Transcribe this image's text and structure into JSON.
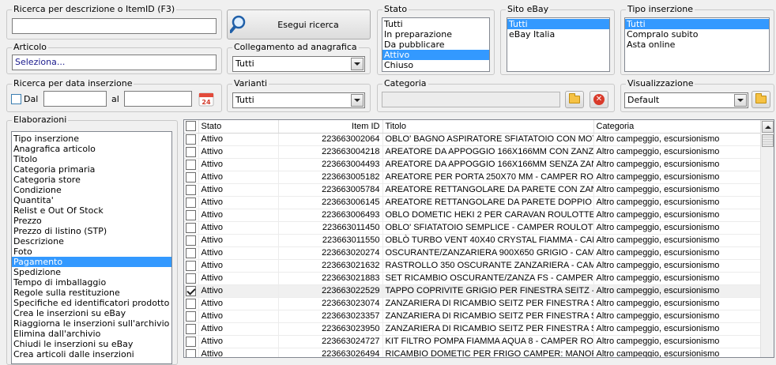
{
  "search": {
    "legend": "Ricerca per descrizione o ItemID (F3)",
    "value": "",
    "button_label": "Esegui ricerca"
  },
  "articolo": {
    "legend": "Articolo",
    "value": "Seleziona..."
  },
  "collegamento": {
    "legend": "Collegamento ad anagrafica",
    "value": "Tutti"
  },
  "stato": {
    "legend": "Stato",
    "options": [
      "Tutti",
      "In preparazione",
      "Da pubblicare",
      "Attivo",
      "Chiuso"
    ],
    "selected": "Attivo"
  },
  "sito": {
    "legend": "Sito eBay",
    "options": [
      "Tutti",
      "eBay Italia"
    ],
    "selected": "Tutti"
  },
  "tipo": {
    "legend": "Tipo inserzione",
    "options": [
      "Tutti",
      "Compralo subito",
      "Asta online"
    ],
    "selected": "Tutti"
  },
  "data": {
    "legend": "Ricerca per data inserzione",
    "dal_label": "Dal",
    "al_label": "al",
    "dal_value": "",
    "al_value": "",
    "calendar_text": "24"
  },
  "varianti": {
    "legend": "Varianti",
    "value": "Tutti"
  },
  "categoria": {
    "legend": "Categoria",
    "value": ""
  },
  "visualizzazione": {
    "legend": "Visualizzazione",
    "value": "Default"
  },
  "elaborazioni": {
    "legend": "Elaborazioni",
    "items": [
      "Tipo inserzione",
      "Anagrafica articolo",
      "Titolo",
      "Categoria primaria",
      "Categoria store",
      "Condizione",
      "Quantita'",
      "Relist e Out Of Stock",
      "Prezzo",
      "Prezzo di listino (STP)",
      "Descrizione",
      "Foto",
      "Pagamento",
      "Spedizione",
      "Tempo di imballaggio",
      "Regole sulla restituzione",
      "Specifiche ed identificatori prodotto",
      "Crea le inserzioni su eBay",
      "Riaggiorna le inserzioni sull'archivio",
      "Elimina dall'archivio",
      "Chiudi le inserzioni su eBay",
      "Crea articoli dalle inserzioni"
    ],
    "selected": "Pagamento"
  },
  "grid": {
    "columns": [
      "Stato",
      "Item ID",
      "Titolo",
      "Categoria"
    ],
    "rows": [
      {
        "checked": false,
        "stato": "Attivo",
        "id": "223663002064",
        "titolo": "OBLO' BAGNO ASPIRATORE SFIATATOIO CON MOT...",
        "categoria": "Altro campeggio, escursionismo"
      },
      {
        "checked": false,
        "stato": "Attivo",
        "id": "223663004218",
        "titolo": "AREATORE DA APPOGGIO 166X166MM CON ZANZA...",
        "categoria": "Altro campeggio, escursionismo"
      },
      {
        "checked": false,
        "stato": "Attivo",
        "id": "223663004493",
        "titolo": "AREATORE DA APPOGGIO 166X166MM SENZA ZAN...",
        "categoria": "Altro campeggio, escursionismo"
      },
      {
        "checked": false,
        "stato": "Attivo",
        "id": "223663005182",
        "titolo": "AREATORE PER PORTA 250X70 MM - CAMPER ROU...",
        "categoria": "Altro campeggio, escursionismo"
      },
      {
        "checked": false,
        "stato": "Attivo",
        "id": "223663005784",
        "titolo": "AREATORE RETTANGOLARE DA PARETE CON ZANZ...",
        "categoria": "Altro campeggio, escursionismo"
      },
      {
        "checked": false,
        "stato": "Attivo",
        "id": "223663006145",
        "titolo": "AREATORE RETTANGOLARE DA PARETE DOPPIO C...",
        "categoria": "Altro campeggio, escursionismo"
      },
      {
        "checked": false,
        "stato": "Attivo",
        "id": "223663006493",
        "titolo": "OBLO DOMETIC HEKI 2 PER CARAVAN ROULOTTE",
        "categoria": "Altro campeggio, escursionismo"
      },
      {
        "checked": false,
        "stato": "Attivo",
        "id": "223663011450",
        "titolo": "OBLO' SFIATATOIO SEMPLICE - CAMPER ROULOTTE",
        "categoria": "Altro campeggio, escursionismo"
      },
      {
        "checked": false,
        "stato": "Attivo",
        "id": "223663011550",
        "titolo": "OBLÒ TURBO VENT 40X40 CRYSTAL FIAMMA - CAM...",
        "categoria": "Altro campeggio, escursionismo"
      },
      {
        "checked": false,
        "stato": "Attivo",
        "id": "223663020274",
        "titolo": "OSCURANTE/ZANZARIERA 900X650 GRIGIO - CAM...",
        "categoria": "Altro campeggio, escursionismo"
      },
      {
        "checked": false,
        "stato": "Attivo",
        "id": "223663021632",
        "titolo": "RASTROLLO 350 OSCURANTE ZANZARIERA - CAMP...",
        "categoria": "Altro campeggio, escursionismo"
      },
      {
        "checked": false,
        "stato": "Attivo",
        "id": "223663021883",
        "titolo": "SET RICAMBIO OSCURANTE/ZANZA FS - CAMPER R...",
        "categoria": "Altro campeggio, escursionismo"
      },
      {
        "checked": true,
        "stato": "Attivo",
        "id": "223663022529",
        "titolo": "TAPPO COPRIVITE GRIGIO PER FINESTRA SEITZ  - ...",
        "categoria": "Altro campeggio, escursionismo"
      },
      {
        "checked": false,
        "stato": "Attivo",
        "id": "223663023074",
        "titolo": "ZANZARIERA DI RICAMBIO SEITZ PER FINESTRA S...",
        "categoria": "Altro campeggio, escursionismo"
      },
      {
        "checked": false,
        "stato": "Attivo",
        "id": "223663023357",
        "titolo": "ZANZARIERA DI RICAMBIO SEITZ PER FINESTRA S...",
        "categoria": "Altro campeggio, escursionismo"
      },
      {
        "checked": false,
        "stato": "Attivo",
        "id": "223663023950",
        "titolo": "ZANZARIERA DI RICAMBIO SEITZ PER FINESTRA S...",
        "categoria": "Altro campeggio, escursionismo"
      },
      {
        "checked": false,
        "stato": "Attivo",
        "id": "223663024727",
        "titolo": "KIT FILTRO POMPA FIAMMA AQUA 8 - CAMPER RO...",
        "categoria": "Altro campeggio, escursionismo"
      },
      {
        "checked": false,
        "stato": "Attivo",
        "id": "223663026494",
        "titolo": "RICAMBIO DOMETIC PER FRIGO CAMPER: MANOP...",
        "categoria": "Altro campeggio, escursionismo"
      }
    ]
  }
}
